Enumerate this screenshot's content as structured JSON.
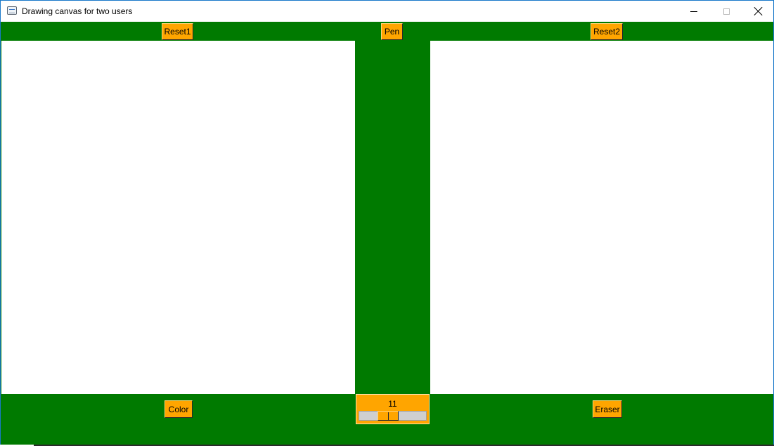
{
  "window": {
    "title": "Drawing canvas for two users",
    "icon": "app-window-icon",
    "controls": {
      "minimize": "minimize-icon",
      "maximize": "maximize-icon",
      "close": "close-icon"
    }
  },
  "toolbar": {
    "reset1_label": "Reset1",
    "pen_label": "Pen",
    "reset2_label": "Reset2"
  },
  "bottom": {
    "color_label": "Color",
    "eraser_label": "Eraser",
    "slider": {
      "value": "11",
      "level": 0.4
    }
  },
  "colors": {
    "background": "#007a00",
    "button": "#ffa500",
    "canvas": "#ffffff",
    "slider_trough": "#cfcfcf"
  }
}
